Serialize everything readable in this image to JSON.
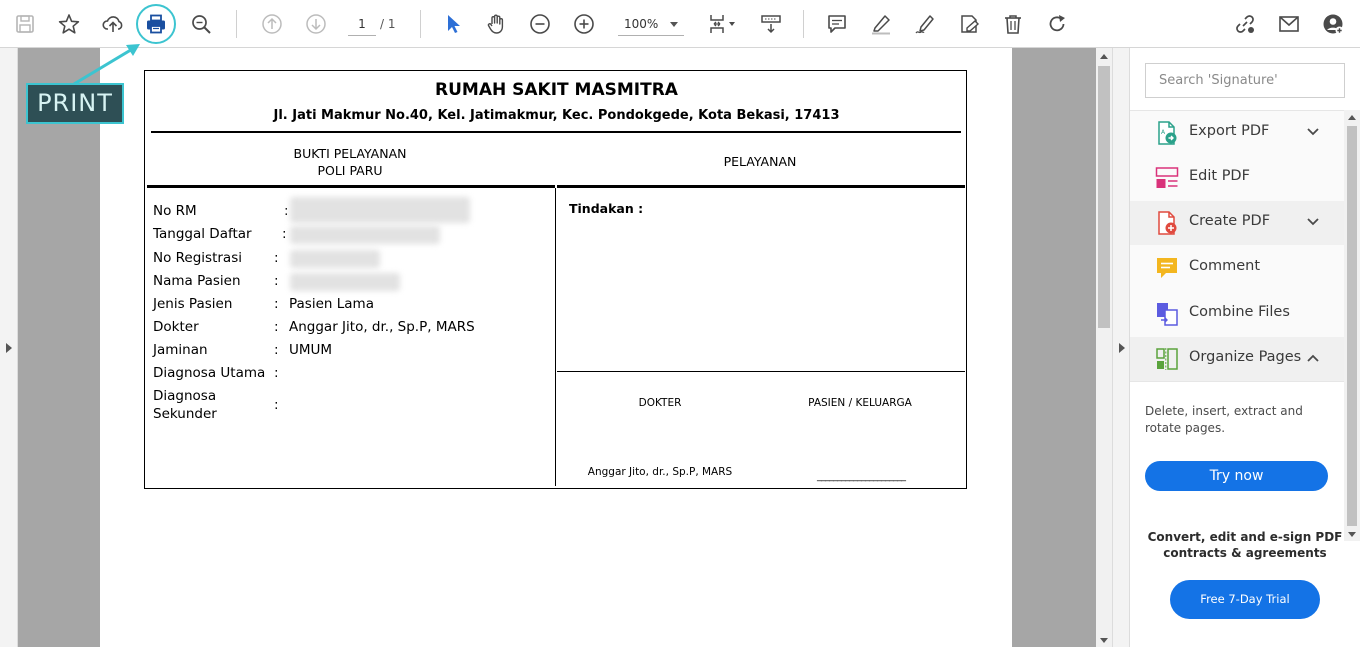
{
  "toolbar": {
    "icons": [
      "save-icon",
      "bookmark-star-icon",
      "upload-cloud-icon",
      "print-icon",
      "zoom-search-icon",
      "page-up-icon",
      "page-down-icon",
      "select-pointer-icon",
      "pan-hand-icon",
      "zoom-out-icon",
      "zoom-in-icon",
      "page-fit-icon",
      "scroll-mode-icon",
      "comment-icon",
      "highlight-pen-icon",
      "sign-icon",
      "fill-sign-icon",
      "delete-icon",
      "rotate-icon",
      "share-link-icon",
      "email-icon",
      "account-icon"
    ],
    "page_current": "1",
    "page_total": "/ 1",
    "zoom": "100%"
  },
  "annotation": {
    "label": "PRINT",
    "color": "#3cc4d0"
  },
  "document": {
    "hospital": "RUMAH SAKIT MASMITRA",
    "address": "Jl. Jati Makmur No.40, Kel. Jatimakmur, Kec. Pondokgede, Kota Bekasi, 17413",
    "left_header_1": "BUKTI PELAYANAN",
    "left_header_2": "POLI PARU",
    "right_header": "PELAYANAN",
    "fields": [
      {
        "label": "No RM",
        "value": ""
      },
      {
        "label": "Tanggal Daftar",
        "value": ""
      },
      {
        "label": "No Registrasi",
        "value": ""
      },
      {
        "label": "Nama Pasien",
        "value": ""
      },
      {
        "label": "Jenis Pasien",
        "value": "Pasien Lama"
      },
      {
        "label": "Dokter",
        "value": "Anggar Jito, dr., Sp.P, MARS"
      },
      {
        "label": "Jaminan",
        "value": "UMUM"
      },
      {
        "label": "Diagnosa Utama",
        "value": ""
      },
      {
        "label": "Diagnosa",
        "label2": "Sekunder",
        "value": ""
      }
    ],
    "colon": ":",
    "tindakan": "Tindakan :",
    "sig_doctor_title": "DOKTER",
    "sig_patient_title": "PASIEN / KELUARGA",
    "sig_doctor_name": "Anggar Jito, dr., Sp.P, MARS",
    "sig_patient_line": "______________________"
  },
  "right_panel": {
    "search_placeholder": "Search 'Signature'",
    "tools": [
      {
        "label": "Export PDF",
        "icon": "export-pdf-icon",
        "chevron": "down"
      },
      {
        "label": "Edit PDF",
        "icon": "edit-pdf-icon",
        "chevron": ""
      },
      {
        "label": "Create PDF",
        "icon": "create-pdf-icon",
        "chevron": "down"
      },
      {
        "label": "Comment",
        "icon": "comment-tool-icon",
        "chevron": ""
      },
      {
        "label": "Combine Files",
        "icon": "combine-files-icon",
        "chevron": ""
      },
      {
        "label": "Organize Pages",
        "icon": "organize-pages-icon",
        "chevron": "up"
      }
    ],
    "organize_desc": "Delete, insert, extract and rotate pages.",
    "try_now": "Try now",
    "promo": "Convert, edit and e-sign PDF contracts & agreements",
    "trial_button": "Free 7-Day Trial"
  },
  "colors": {
    "accent_blue": "#1473e6",
    "pointer_blue": "#2d6fd6"
  }
}
